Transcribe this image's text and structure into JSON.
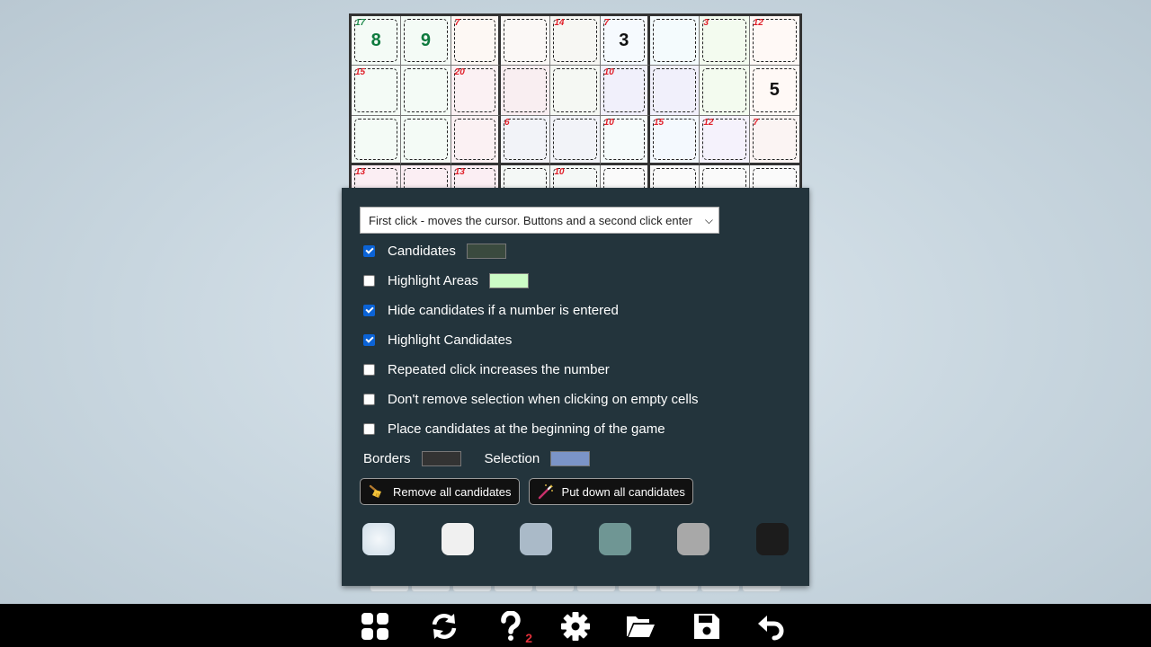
{
  "board": {
    "rows": [
      [
        "8",
        "9",
        "",
        "",
        "",
        "3",
        "",
        "",
        ""
      ],
      [
        "",
        "",
        "",
        "",
        "",
        "",
        "",
        "",
        "5"
      ],
      [
        "",
        "",
        "",
        "",
        "",
        "",
        "",
        "",
        ""
      ],
      [
        "",
        "",
        "",
        "",
        "",
        "",
        "",
        "",
        ""
      ]
    ],
    "given_style": [
      [
        "green",
        "green",
        "",
        "",
        "",
        "black",
        "",
        "",
        ""
      ],
      [
        "",
        "",
        "",
        "",
        "",
        "",
        "",
        "",
        "black"
      ]
    ],
    "cage_sums": [
      {
        "row": 0,
        "col": 0,
        "sum": "17",
        "color": "green"
      },
      {
        "row": 0,
        "col": 2,
        "sum": "7",
        "color": "red"
      },
      {
        "row": 0,
        "col": 4,
        "sum": "14",
        "color": "red"
      },
      {
        "row": 0,
        "col": 5,
        "sum": "7",
        "color": "red"
      },
      {
        "row": 0,
        "col": 7,
        "sum": "3",
        "color": "red"
      },
      {
        "row": 0,
        "col": 8,
        "sum": "12",
        "color": "red"
      },
      {
        "row": 1,
        "col": 0,
        "sum": "15",
        "color": "red"
      },
      {
        "row": 1,
        "col": 2,
        "sum": "20",
        "color": "red"
      },
      {
        "row": 1,
        "col": 5,
        "sum": "10",
        "color": "red"
      },
      {
        "row": 2,
        "col": 3,
        "sum": "6",
        "color": "red"
      },
      {
        "row": 2,
        "col": 5,
        "sum": "10",
        "color": "red"
      },
      {
        "row": 2,
        "col": 6,
        "sum": "15",
        "color": "red"
      },
      {
        "row": 2,
        "col": 7,
        "sum": "12",
        "color": "red"
      },
      {
        "row": 2,
        "col": 8,
        "sum": "7",
        "color": "red"
      },
      {
        "row": 3,
        "col": 0,
        "sum": "13",
        "color": "red"
      },
      {
        "row": 3,
        "col": 2,
        "sum": "13",
        "color": "red"
      },
      {
        "row": 3,
        "col": 4,
        "sum": "10",
        "color": "red"
      }
    ],
    "cell_tints": [
      [
        "#f4fbf6",
        "#f4fbf6",
        "#fdf8f4",
        "#fbf8f6",
        "#f7f7f3",
        "#f6fafe",
        "#f4fbfd",
        "#f3fbef",
        "#fff9f6"
      ],
      [
        "#f4fbf6",
        "#f4fbf6",
        "#fbf1f3",
        "#f9eef1",
        "#f5f8f3",
        "#f1f0fb",
        "#f1f0fb",
        "#f3fbef",
        "#fff9f6"
      ],
      [
        "#f4fbf6",
        "#f4fbf6",
        "#fbf1f3",
        "#f2f3f8",
        "#f2f3f8",
        "#f6fbfb",
        "#f4f9fe",
        "#f5f2fc",
        "#fbf4f3"
      ],
      [
        "#fbeef3",
        "#fbeef3",
        "#fbeef3",
        "#f4f8f6",
        "#f4f8f6",
        "#fafafa",
        "#fafafa",
        "#fafafa",
        "#fafafa"
      ]
    ]
  },
  "settings": {
    "input_mode": "First click - moves the cursor. Buttons and a second click enter",
    "options": [
      {
        "label": "Candidates",
        "checked": true,
        "swatch": "#3a4a3e"
      },
      {
        "label": "Highlight Areas",
        "checked": false,
        "swatch": "#ccfcc6"
      },
      {
        "label": "Hide candidates if a number is entered",
        "checked": true
      },
      {
        "label": "Highlight Candidates",
        "checked": true
      },
      {
        "label": "Repeated click increases the number",
        "checked": false
      },
      {
        "label": "Don't remove selection when clicking on empty cells",
        "checked": false
      },
      {
        "label": "Place candidates at the beginning of the game",
        "checked": false
      }
    ],
    "borders_label": "Borders",
    "borders_color": "#333333",
    "selection_label": "Selection",
    "selection_color": "#7b94c8",
    "remove_candidates_label": "Remove all candidates",
    "put_candidates_label": "Put down all candidates",
    "themes": [
      {
        "name": "light-blue",
        "color": "#dbe6ee"
      },
      {
        "name": "white",
        "color": "#f0f0f0"
      },
      {
        "name": "slate",
        "color": "#aabac8"
      },
      {
        "name": "teal",
        "color": "#6f9694"
      },
      {
        "name": "gray",
        "color": "#a8a8a8"
      },
      {
        "name": "black",
        "color": "#1c1c1c"
      }
    ]
  },
  "toolbar": {
    "help_count": "2"
  }
}
